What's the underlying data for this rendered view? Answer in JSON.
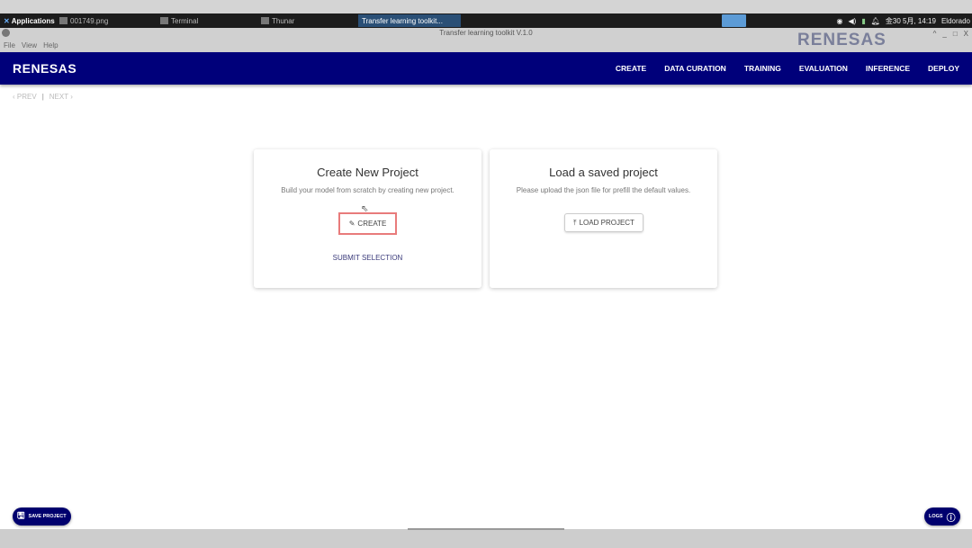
{
  "taskbar": {
    "applications": "Applications",
    "tasks": [
      "001749.png",
      "Terminal",
      "Thunar",
      "Transfer learning toolkit..."
    ],
    "tray": {
      "datetime": "金30 5月, 14:19",
      "user": "Eldorado"
    }
  },
  "window": {
    "title": "Transfer learning toolkit V.1.0",
    "menu": [
      "File",
      "View",
      "Help"
    ],
    "brand": "RENESAS",
    "controls": [
      "^",
      "_",
      "□",
      "X"
    ]
  },
  "header": {
    "logo": "RENESAS",
    "nav": [
      "CREATE",
      "DATA CURATION",
      "TRAINING",
      "EVALUATION",
      "INFERENCE",
      "DEPLOY"
    ],
    "color": "#00007a"
  },
  "stepper": {
    "prev": "PREV",
    "separator": "|",
    "next": "NEXT"
  },
  "cards": {
    "create": {
      "title": "Create New Project",
      "description": "Build your model from scratch by creating new project.",
      "button": "CREATE",
      "submit": "SUBMIT SELECTION"
    },
    "load": {
      "title": "Load a saved project",
      "description": "Please upload the json file for prefill the default values.",
      "button": "LOAD PROJECT"
    }
  },
  "footer": {
    "save": "SAVE PROJECT",
    "logs": "LOGS"
  }
}
